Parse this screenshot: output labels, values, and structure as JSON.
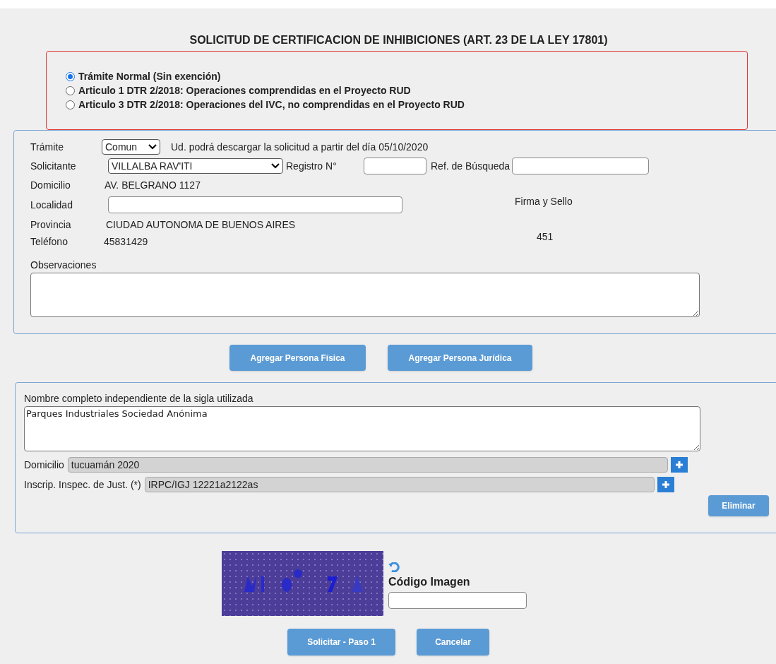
{
  "title": "SOLICITUD DE CERTIFICACION DE INHIBICIONES (ART. 23 DE LA LEY 17801)",
  "exemptions": [
    {
      "label": "Trámite Normal (Sin exención)",
      "selected": true
    },
    {
      "label": "Articulo 1 DTR 2/2018: Operaciones comprendidas en el Proyecto RUD",
      "selected": false
    },
    {
      "label": "Articulo 3 DTR 2/2018: Operaciones del IVC, no comprendidas en el Proyecto RUD",
      "selected": false
    }
  ],
  "request": {
    "tramite": {
      "label": "Trámite",
      "value": "Comun",
      "note": "Ud. podrá descargar la solicitud a partir del día 05/10/2020"
    },
    "solicitante": {
      "label": "Solicitante",
      "value": "VILLALBA RAV'ITI"
    },
    "registro": {
      "label": "Registro N°"
    },
    "ref_busqueda": {
      "label": "Ref. de Búsqueda"
    },
    "domicilio": {
      "label": "Domicilio",
      "value": "AV. BELGRANO 1127"
    },
    "localidad": {
      "label": "Localidad"
    },
    "firma": {
      "label": "Firma y Sello",
      "value": "451"
    },
    "provincia": {
      "label": "Provincia",
      "value": "CIUDAD AUTONOMA DE BUENOS AIRES"
    },
    "telefono": {
      "label": "Teléfono",
      "value": "45831429"
    },
    "observaciones": {
      "label": "Observaciones"
    }
  },
  "add_buttons": [
    "Agregar Persona Física",
    "Agregar Persona Jurídica"
  ],
  "person": {
    "name": {
      "label": "Nombre completo independiente de la sigla utilizada",
      "value": "Parques Industriales Sociedad Anónima"
    },
    "domicilio": {
      "label": "Domicilio",
      "value": "tucuamán 2020"
    },
    "inscripcion": {
      "label": "Inscrip. Inspec. de Just. (*)",
      "value": "IRPC/IGJ 12221a2122as"
    },
    "delete_button": "Eliminar"
  },
  "captcha": {
    "kind": "picture",
    "label": "Código Imagen"
  },
  "actions": [
    "Solicitar - Paso 1",
    "Cancelar"
  ]
}
